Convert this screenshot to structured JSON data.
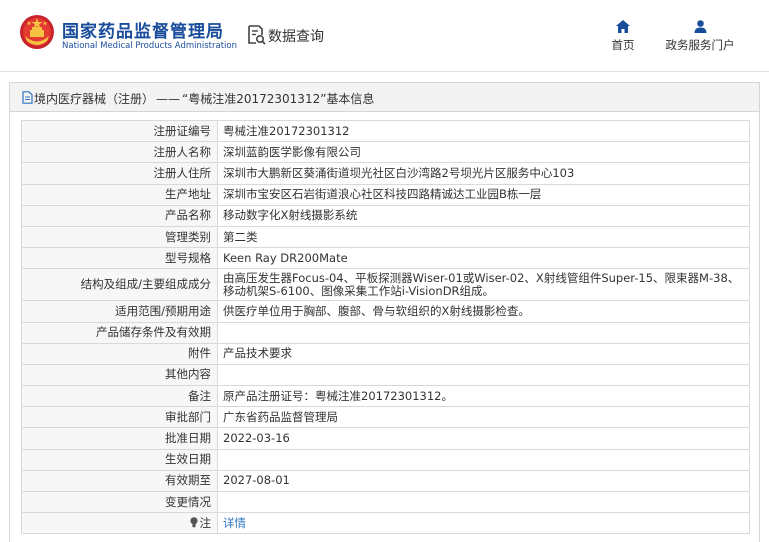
{
  "header": {
    "brand_cn": "国家药品监督管理局",
    "brand_en": "National Medical Products Administration",
    "query_label": "数据查询",
    "nav": {
      "home": "首页",
      "service": "政务服务门户"
    }
  },
  "breadcrumb": {
    "section": "境内医疗器械（注册）",
    "separator": "——",
    "title": "“粤械注准20172301312”基本信息"
  },
  "fields": [
    {
      "label": "注册证编号",
      "value": "粤械注准20172301312"
    },
    {
      "label": "注册人名称",
      "value": "深圳蓝韵医学影像有限公司"
    },
    {
      "label": "注册人住所",
      "value": "深圳市大鹏新区葵涌街道坝光社区白沙湾路2号坝光片区服务中心103"
    },
    {
      "label": "生产地址",
      "value": "深圳市宝安区石岩街道浪心社区科技四路精诚达工业园B栋一层"
    },
    {
      "label": "产品名称",
      "value": "移动数字化X射线摄影系统"
    },
    {
      "label": "管理类别",
      "value": "第二类"
    },
    {
      "label": "型号规格",
      "value": "Keen Ray DR200Mate"
    },
    {
      "label": "结构及组成/主要组成成分",
      "value": "由高压发生器Focus-04、平板探测器Wiser-01或Wiser-02、X射线管组件Super-15、限束器M-38、移动机架S-6100、图像采集工作站i-VisionDR组成。"
    },
    {
      "label": "适用范围/预期用途",
      "value": "供医疗单位用于胸部、腹部、骨与软组织的X射线摄影检查。"
    },
    {
      "label": "产品储存条件及有效期",
      "value": ""
    },
    {
      "label": "附件",
      "value": "产品技术要求"
    },
    {
      "label": "其他内容",
      "value": ""
    },
    {
      "label": "备注",
      "value": "原产品注册证号：粤械注准20172301312。"
    },
    {
      "label": "审批部门",
      "value": "广东省药品监督管理局"
    },
    {
      "label": "批准日期",
      "value": "2022-03-16"
    },
    {
      "label": "生效日期",
      "value": ""
    },
    {
      "label": "有效期至",
      "value": "2027-08-01"
    },
    {
      "label": "变更情况",
      "value": ""
    },
    {
      "label": "注",
      "value": "详情"
    }
  ],
  "icons": {
    "logo": "national-emblem-icon",
    "query": "document-search-icon",
    "home": "home-icon",
    "service": "user-icon",
    "breadcrumb": "document-icon",
    "note": "lightbulb-icon"
  },
  "colors": {
    "brand": "#1a4c9c",
    "link": "#2f74c0",
    "label_bg": "#f7f7f7",
    "head_bg": "#f3f3f3"
  }
}
